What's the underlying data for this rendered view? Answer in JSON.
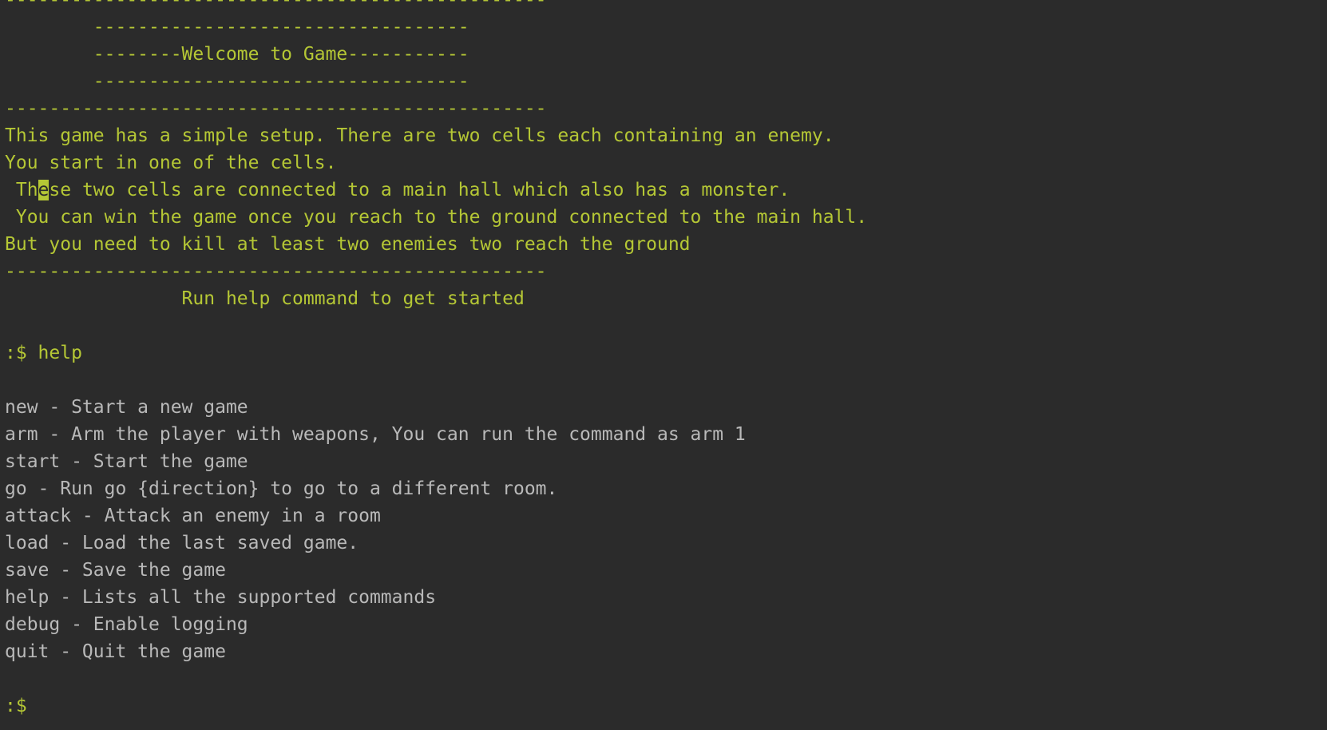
{
  "colors": {
    "background": "#2b2b2b",
    "banner_text": "#b5c735",
    "help_text": "#b9b9b9"
  },
  "banner": {
    "rule_long": "-------------------------------------------------",
    "rule_short": "        ----------------------------------",
    "welcome": "        --------Welcome to Game-----------",
    "rule_short_2": "        ----------------------------------",
    "rule_long_2": "-------------------------------------------------"
  },
  "intro": {
    "line1": "This game has a simple setup. There are two cells each containing an enemy.",
    "line2": "You start in one of the cells.",
    "line3_pre": " Th",
    "line3_cursor": "e",
    "line3_post": "se two cells are connected to a main hall which also has a monster.",
    "line4": " You can win the game once you reach to the ground connected to the main hall.",
    "line5": "But you need to kill at least two enemies two reach the ground",
    "rule": "-------------------------------------------------",
    "hint": "                Run help command to get started"
  },
  "prompt": {
    "first": ":$ help",
    "last": ":$"
  },
  "commands": [
    "new - Start a new game",
    "arm - Arm the player with weapons, You can run the command as arm 1",
    "start - Start the game",
    "go - Run go {direction} to go to a different room.",
    "attack - Attack an enemy in a room",
    "load - Load the last saved game.",
    "save - Save the game",
    "help - Lists all the supported commands",
    "debug - Enable logging",
    "quit - Quit the game"
  ]
}
